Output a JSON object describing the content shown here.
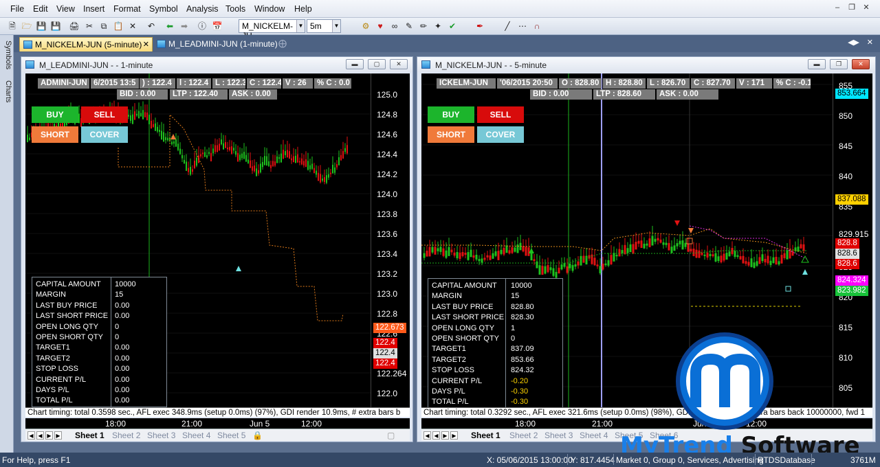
{
  "menu": [
    "File",
    "Edit",
    "View",
    "Insert",
    "Format",
    "Symbol",
    "Analysis",
    "Tools",
    "Window",
    "Help"
  ],
  "toolbar": {
    "symbol_combo": "M_NICKELM-JU",
    "interval_combo": "5m"
  },
  "left_dock": {
    "tab1": "Symbols",
    "tab2": "Charts"
  },
  "doc_tabs": [
    {
      "label": "M_NICKELM-JUN (5-minute)",
      "active": true
    },
    {
      "label": "M_LEADMINI-JUN (1-minute)",
      "active": false
    }
  ],
  "chart_left": {
    "title": "M_LEADMINI-JUN -  - 1-minute",
    "info_line1": [
      "ADMINI-JUN",
      "6/2015 13:5",
      ") : 122.4",
      "l : 122.4",
      "L : 122.3",
      "C : 122.4",
      "V : 26",
      "% C : 0.0"
    ],
    "info_line2": [
      "BID : 0.00",
      "LTP : 122.40",
      "ASK : 0.00"
    ],
    "buttons": {
      "buy": "BUY",
      "sell": "SELL",
      "short": "SHORT",
      "cover": "COVER"
    },
    "axis_ticks": [
      "125.0",
      "124.8",
      "124.6",
      "124.4",
      "124.2",
      "124.0",
      "123.8",
      "123.6",
      "123.4",
      "123.2",
      "123.0",
      "122.8",
      "122.6",
      "122.4",
      "122.264",
      "122.0"
    ],
    "price_tags": [
      {
        "text": "122.673",
        "color": "#ff5a1a"
      },
      {
        "text": "122.4",
        "color": "#e00000"
      },
      {
        "text": "122.4",
        "color": "#e0e0e0"
      },
      {
        "text": "122.4",
        "color": "#e00000"
      }
    ],
    "panel": {
      "labels": [
        "CAPITAL AMOUNT",
        "MARGIN",
        "LAST BUY PRICE",
        "LAST SHORT PRICE",
        "OPEN LONG QTY",
        "OPEN SHORT QTY",
        "TARGET1",
        "TARGET2",
        "STOP LOSS",
        "CURRENT P/L",
        "DAYS P/L",
        "TOTAL P/L"
      ],
      "values": [
        "10000",
        "15",
        "0.00",
        "0.00",
        "0",
        "0",
        "0.00",
        "0.00",
        "0.00",
        "0.00",
        "0.00",
        "0.00"
      ]
    },
    "timing": "Chart timing: total 0.3598 sec., AFL exec 348.9ms (setup 0.0ms) (97%), GDI render 10.9ms, # extra bars b",
    "x_labels": [
      "18:00",
      "21:00",
      "Jun 5",
      "12:00"
    ],
    "sheets": [
      "Sheet 1",
      "Sheet 2",
      "Sheet 3",
      "Sheet 4",
      "Sheet 5"
    ]
  },
  "chart_right": {
    "title": "M_NICKELM-JUN -  - 5-minute",
    "info_line1": [
      "ICKELM-JUN",
      "'06/2015 20:50",
      "O : 828.80",
      "H : 828.80",
      "L : 826.70",
      "C : 827.70",
      "V : 171",
      "% C : -0.13"
    ],
    "info_line2": [
      "BID : 0.00",
      "LTP : 828.60",
      "ASK : 0.00"
    ],
    "buttons": {
      "buy": "BUY",
      "sell": "SELL",
      "short": "SHORT",
      "cover": "COVER"
    },
    "axis_ticks": [
      "855",
      "850",
      "845",
      "840",
      "835",
      "829.915",
      "825",
      "820",
      "815",
      "810",
      "805"
    ],
    "price_tags": [
      {
        "text": "853.664",
        "color": "#00e5ff"
      },
      {
        "text": "837.088",
        "color": "#ffd000"
      },
      {
        "text": "828.8",
        "color": "#e00000"
      },
      {
        "text": "828.6",
        "color": "#e0e0e0"
      },
      {
        "text": "828.6",
        "color": "#e00000"
      },
      {
        "text": "824.324",
        "color": "#ff00ff"
      },
      {
        "text": "823.982",
        "color": "#18c33a"
      }
    ],
    "panel": {
      "labels": [
        "CAPITAL AMOUNT",
        "MARGIN",
        "LAST BUY PRICE",
        "LAST SHORT PRICE",
        "OPEN LONG QTY",
        "OPEN SHORT QTY",
        "TARGET1",
        "TARGET2",
        "STOP LOSS",
        "CURRENT P/L",
        "DAYS P/L",
        "TOTAL P/L"
      ],
      "values": [
        "10000",
        "15",
        "828.80",
        "828.30",
        "1",
        "0",
        "837.09",
        "853.66",
        "824.32",
        "-0.20",
        "-0.30",
        "-0.30"
      ]
    },
    "timing": "Chart timing: total 0.3292 sec., AFL exec 321.6ms (setup 0.0ms) (98%), GDI render 5.4ms, # extra bars back 10000000, fwd 1",
    "x_labels": [
      "18:00",
      "21:00",
      "Jun 5",
      "12:00"
    ],
    "sheets": [
      "Sheet 1",
      "Sheet 2",
      "Sheet 3",
      "Sheet 4",
      "Sheet 5",
      "Sheet 6"
    ]
  },
  "watermark": {
    "brand1": "MyTrend",
    "brand2": " Software"
  },
  "status": {
    "help": "For Help, press F1",
    "xpos": "X: 05/06/2015 13:00:00",
    "ypos": "Y: 817.4454",
    "market": "Market 0, Group 0, Services, Advertising",
    "db": "RTDSDatabase",
    "mem": "3761M"
  }
}
